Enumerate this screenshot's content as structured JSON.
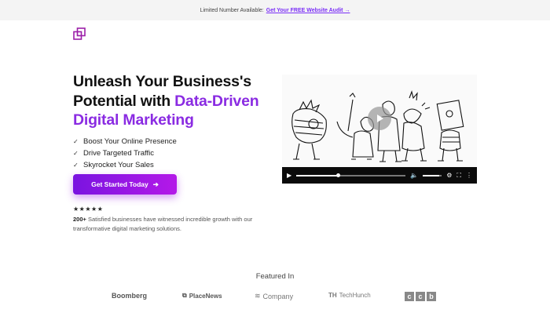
{
  "announcement": {
    "text": "Limited Number Available:",
    "link_label": "Get Your FREE Website Audit →"
  },
  "brand": {
    "logo_icon": "overlapping-squares-icon",
    "accent_color": "#8a2be2"
  },
  "hero": {
    "title_line1": "Unleash Your Business's",
    "title_line2_plain": "Potential with ",
    "title_line2_accent": "Data-Driven",
    "title_line3_accent": "Digital Marketing",
    "features": [
      "Boost Your Online Presence",
      "Drive Targeted Traffic",
      "Skyrocket Your Sales"
    ],
    "cta_label": "Get Started Today",
    "cta_icon": "arrow-right-icon",
    "stars": "★★★★★",
    "testimonial_count": "200+",
    "testimonial_text": " Satisfied businesses have witnessed incredible growth with our transformative digital marketing solutions."
  },
  "video": {
    "progress": 0.38,
    "volume": 0.85
  },
  "featured": {
    "title": "Featured In",
    "logos": [
      "Boomberg",
      "PlaceNews",
      "Company",
      "TechHunch",
      "c c b"
    ]
  }
}
